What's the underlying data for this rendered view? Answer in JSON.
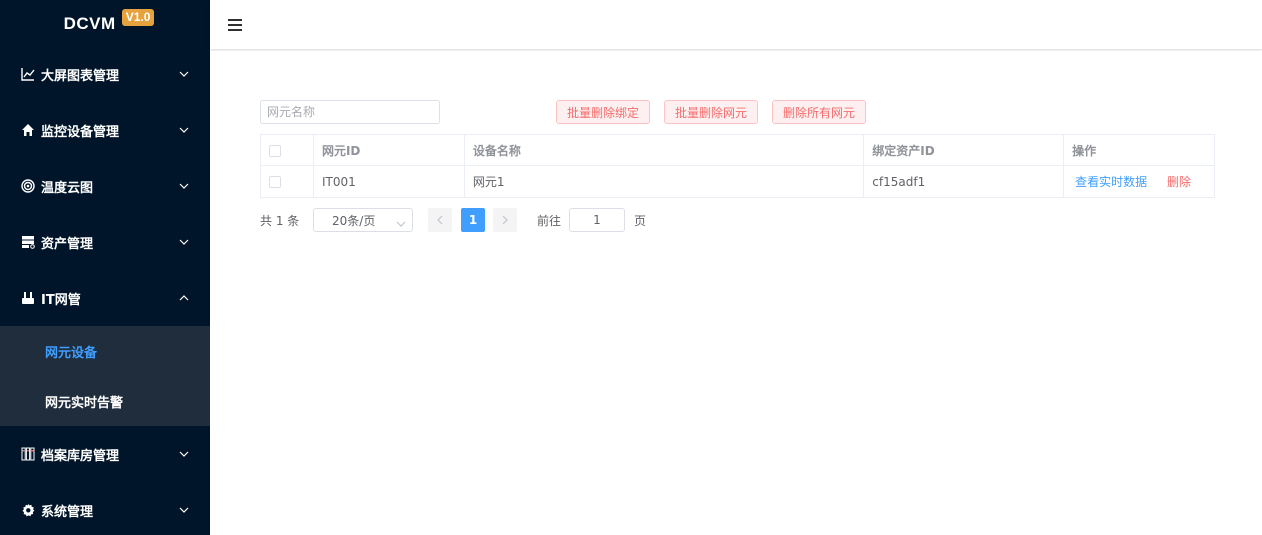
{
  "brand": {
    "name": "DCVM",
    "version": "V1.0"
  },
  "sidebar": {
    "items": [
      {
        "label": "大屏图表管理",
        "icon": "line-chart-icon",
        "expanded": false
      },
      {
        "label": "监控设备管理",
        "icon": "home-icon",
        "expanded": false
      },
      {
        "label": "温度云图",
        "icon": "target-icon",
        "expanded": false
      },
      {
        "label": "资产管理",
        "icon": "server-icon",
        "expanded": false
      },
      {
        "label": "IT网管",
        "icon": "printer-icon",
        "expanded": true,
        "children": [
          {
            "label": "网元设备",
            "active": true
          },
          {
            "label": "网元实时告警",
            "active": false
          }
        ]
      },
      {
        "label": "档案库房管理",
        "icon": "archive-icon",
        "expanded": false
      },
      {
        "label": "系统管理",
        "icon": "gear-icon",
        "expanded": false
      }
    ]
  },
  "header": {
    "menu_icon": "hamburger-icon"
  },
  "toolbar": {
    "search_placeholder": "网元名称",
    "search_value": "",
    "buttons": [
      "批量删除绑定",
      "批量删除网元",
      "删除所有网元"
    ]
  },
  "table": {
    "columns": [
      "网元ID",
      "设备名称",
      "绑定资产ID",
      "操作"
    ],
    "rows": [
      {
        "id": "IT001",
        "name": "网元1",
        "asset_id": "cf15adf1",
        "actions": [
          "查看实时数据",
          "删除"
        ]
      }
    ]
  },
  "pagination": {
    "total_text": "共 1 条",
    "page_size": "20条/页",
    "current_page": "1",
    "goto_label": "前往",
    "goto_value": "1",
    "page_suffix": "页"
  },
  "colors": {
    "sidebar_bg": "#001529",
    "accent": "#409eff",
    "danger": "#f56c6c",
    "badge": "#e6a23c"
  }
}
